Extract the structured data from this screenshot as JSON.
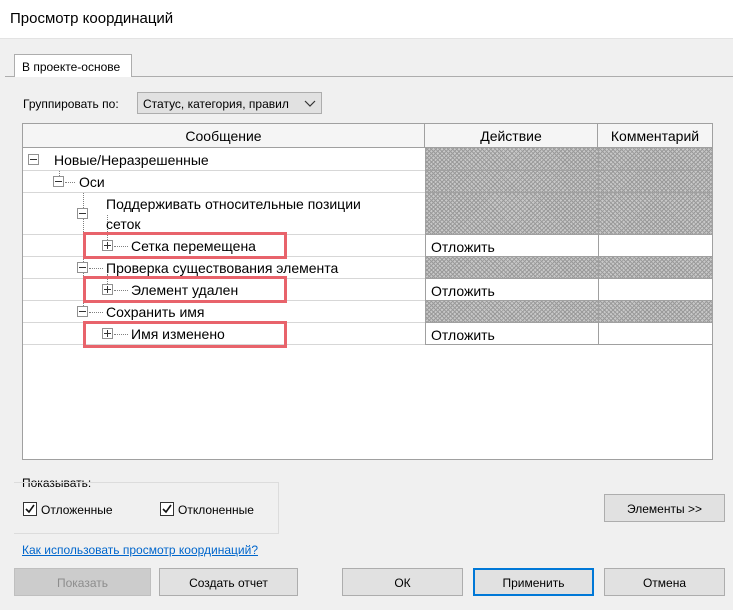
{
  "window": {
    "title": "Просмотр координаций"
  },
  "tab": {
    "label": "В проекте-основе"
  },
  "group": {
    "label": "Группировать по:",
    "value": "Статус, категория, правил"
  },
  "grid": {
    "headers": [
      "Сообщение",
      "Действие",
      "Комментарий"
    ],
    "rows": [
      {
        "text": "Новые/Неразрешенные",
        "action": ""
      },
      {
        "text": "Оси",
        "action": ""
      },
      {
        "text1": "Поддерживать относительные позиции",
        "text2": "сеток",
        "action": ""
      },
      {
        "text": "Сетка перемещена",
        "action": "Отложить"
      },
      {
        "text": "Проверка существования элемента",
        "action": ""
      },
      {
        "text": "Элемент удален",
        "action": "Отложить"
      },
      {
        "text": "Сохранить имя",
        "action": ""
      },
      {
        "text": "Имя изменено",
        "action": "Отложить"
      }
    ]
  },
  "show": {
    "label": "Показывать:",
    "postponed": {
      "label": "Отложенные",
      "checked": true
    },
    "rejected": {
      "label": "Отклоненные",
      "checked": true
    }
  },
  "buttons": {
    "elements": "Элементы >>",
    "show": "Показать",
    "report": "Создать отчет",
    "ok": "ОК",
    "apply": "Применить",
    "cancel": "Отмена"
  },
  "link": "Как использовать просмотр координаций?",
  "colors": {
    "highlight": "#e8636b",
    "link": "#0066cc",
    "default_button_border": "#0078d7"
  }
}
